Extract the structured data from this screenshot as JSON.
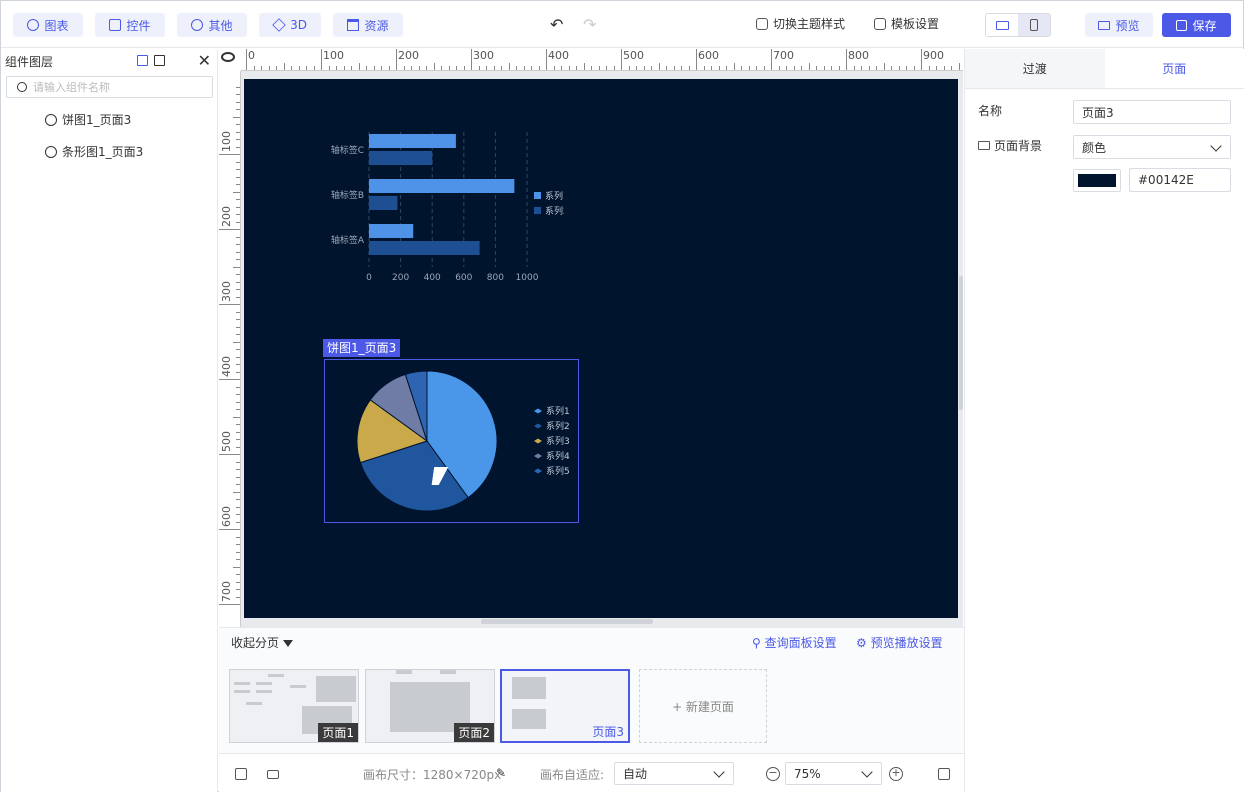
{
  "toolbar": {
    "chart": "图表",
    "widgets": "控件",
    "other": "其他",
    "three_d": "3D",
    "assets": "资源",
    "theme": "切换主题样式",
    "template": "模板设置",
    "preview": "预览",
    "save": "保存"
  },
  "layers": {
    "title": "组件图层",
    "search_placeholder": "请输入组件名称",
    "items": [
      "饼图1_页面3",
      "条形图1_页面3"
    ]
  },
  "ruler": {
    "top": [
      "0",
      "100",
      "200",
      "300",
      "400",
      "500",
      "600",
      "700",
      "800",
      "900"
    ],
    "left": [
      "100",
      "200",
      "300",
      "400",
      "500",
      "600",
      "700"
    ]
  },
  "canvas": {
    "background": "#00142E",
    "selected_label": "饼图1_页面3"
  },
  "chart_data": [
    {
      "type": "bar",
      "orientation": "horizontal",
      "categories": [
        "轴标签A",
        "轴标签B",
        "轴标签C"
      ],
      "series": [
        {
          "name": "系列1",
          "values": [
            280,
            920,
            550
          ],
          "color": "#4F93E8"
        },
        {
          "name": "系列2",
          "values": [
            700,
            180,
            400
          ],
          "color": "#1E4F93"
        }
      ],
      "xticks": [
        "0",
        "200",
        "400",
        "600",
        "800",
        "1000"
      ],
      "xlim": [
        0,
        1000
      ],
      "grid": true,
      "legend": "right"
    },
    {
      "type": "pie",
      "series": [
        {
          "name": "系列1",
          "value": 40,
          "color": "#4A97E9"
        },
        {
          "name": "系列2",
          "value": 30,
          "color": "#1F569E"
        },
        {
          "name": "系列3",
          "value": 15,
          "color": "#C9A94A"
        },
        {
          "name": "系列4",
          "value": 10,
          "color": "#6E7CA6"
        },
        {
          "name": "系列5",
          "value": 5,
          "color": "#2D65B3"
        }
      ],
      "legend": "right"
    }
  ],
  "pages": {
    "collapse": "收起分页",
    "query_panel": "查询面板设置",
    "playback": "预览播放设置",
    "items": [
      "页面1",
      "页面2",
      "页面3"
    ],
    "new_page": "+ 新建页面"
  },
  "bottom": {
    "canvas_size": "画布尺寸：1280×720px",
    "fit_label": "画布自适应:",
    "fit_value": "自动",
    "zoom": "75%"
  },
  "props": {
    "tab_transition": "过渡",
    "tab_page": "页面",
    "name_label": "名称",
    "name_value": "页面3",
    "bg_label": "页面背景",
    "bg_type": "颜色",
    "bg_color": "#00142E"
  }
}
